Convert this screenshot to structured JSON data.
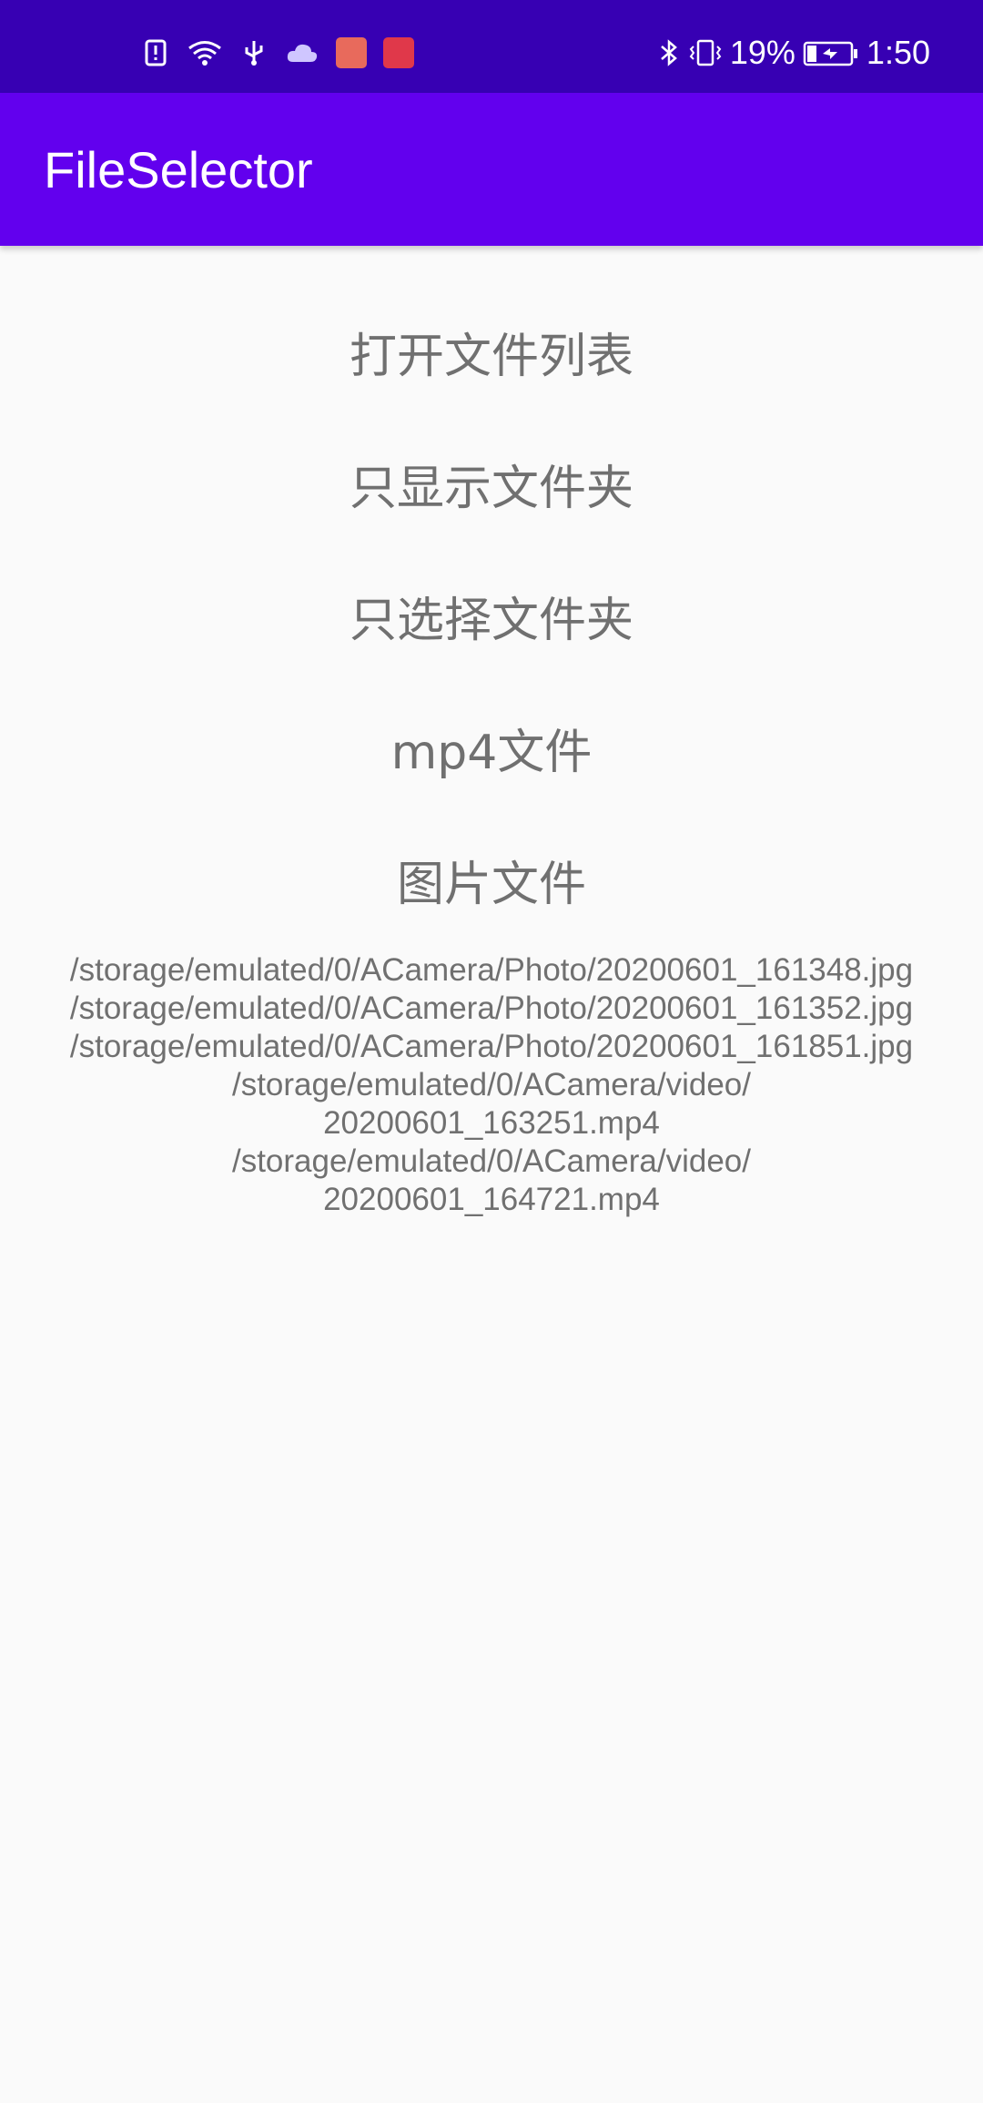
{
  "status_bar": {
    "left_icons": [
      "alert-icon",
      "wifi-icon",
      "usb-icon",
      "cloud-icon",
      "huawei-app-icon",
      "book-app-icon"
    ],
    "battery_percent": "19%",
    "time": "1:50",
    "right_icons": [
      "bluetooth-icon",
      "vibrate-icon",
      "battery-charging-icon"
    ]
  },
  "app_bar": {
    "title": "FileSelector",
    "color": "#6200ee"
  },
  "buttons": {
    "open_file_list": "打开文件列表",
    "show_folders_only": "只显示文件夹",
    "select_folders_only": "只选择文件夹",
    "mp4_files": "mp4文件",
    "image_files": "图片文件"
  },
  "result_lines": [
    "/storage/emulated/0/ACamera/Photo/20200601_161348.jpg",
    "/storage/emulated/0/ACamera/Photo/20200601_161352.jpg",
    "/storage/emulated/0/ACamera/Photo/20200601_161851.jpg",
    "/storage/emulated/0/ACamera/video/",
    "20200601_163251.mp4",
    "/storage/emulated/0/ACamera/video/",
    "20200601_164721.mp4"
  ]
}
